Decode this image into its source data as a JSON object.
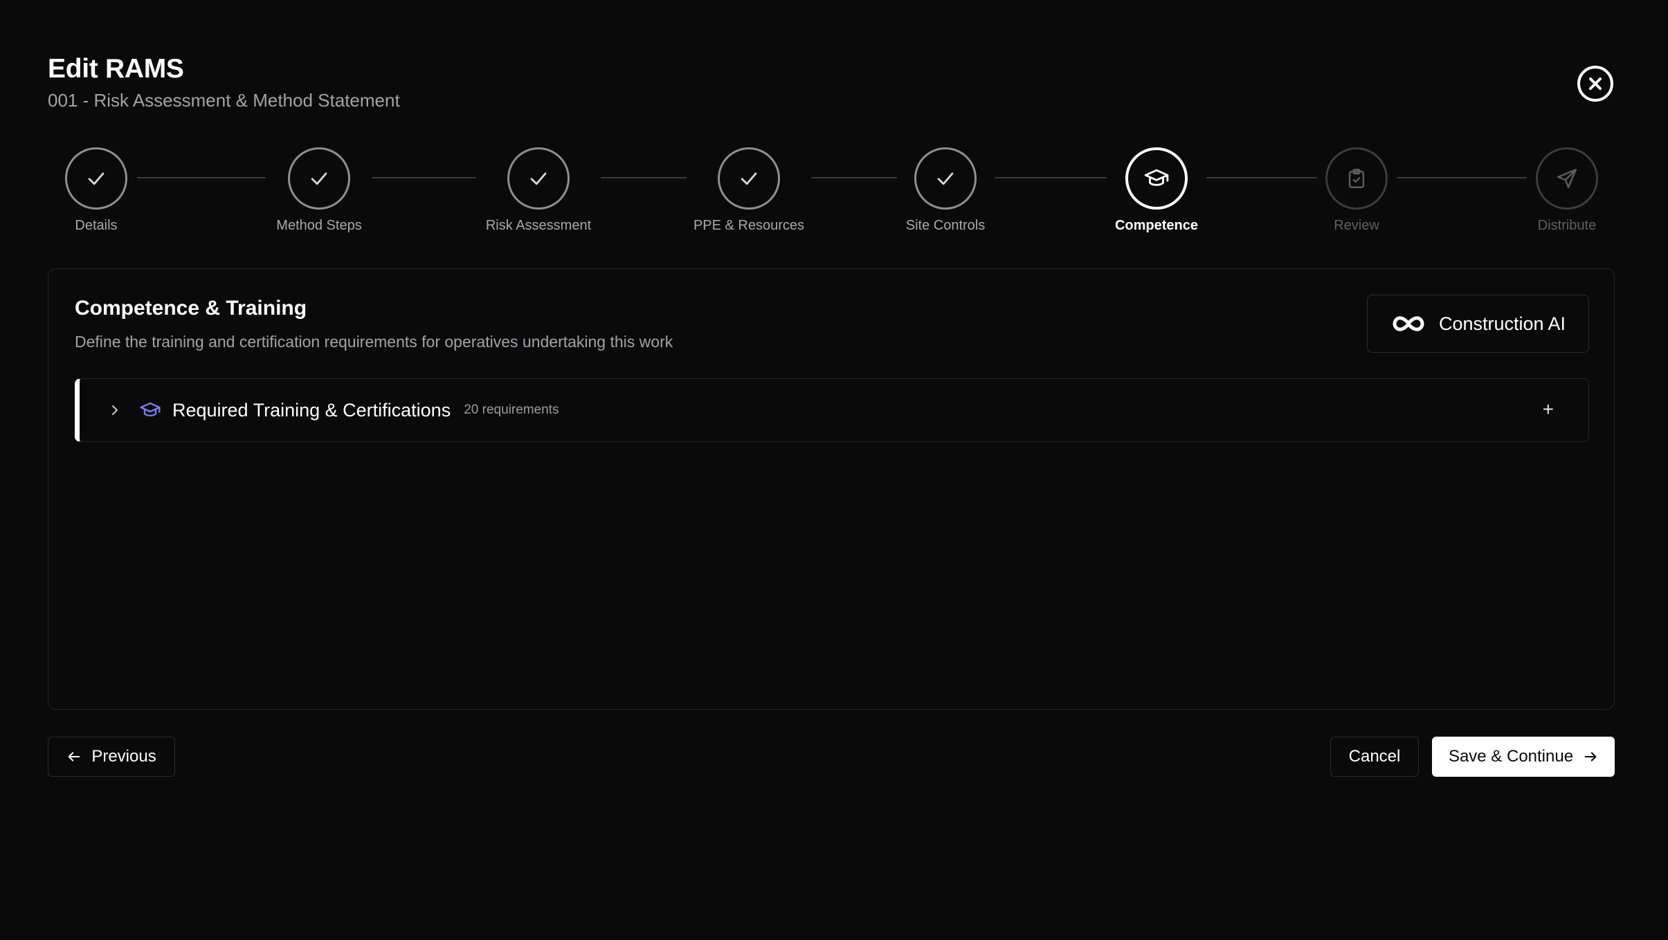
{
  "header": {
    "title": "Edit RAMS",
    "subtitle": "001 - Risk Assessment & Method Statement"
  },
  "stepper": {
    "steps": [
      {
        "label": "Details",
        "state": "complete",
        "icon": "check-icon"
      },
      {
        "label": "Method Steps",
        "state": "complete",
        "icon": "check-icon"
      },
      {
        "label": "Risk Assessment",
        "state": "complete",
        "icon": "check-icon"
      },
      {
        "label": "PPE & Resources",
        "state": "complete",
        "icon": "check-icon"
      },
      {
        "label": "Site Controls",
        "state": "complete",
        "icon": "check-icon"
      },
      {
        "label": "Competence",
        "state": "active",
        "icon": "graduation-cap-icon"
      },
      {
        "label": "Review",
        "state": "pending",
        "icon": "clipboard-check-icon"
      },
      {
        "label": "Distribute",
        "state": "pending",
        "icon": "send-icon"
      }
    ]
  },
  "card": {
    "title": "Competence & Training",
    "description": "Define the training and certification requirements for operatives undertaking this work",
    "ai_button": {
      "label": "Construction AI",
      "icon": "infinity-icon"
    },
    "section": {
      "title": "Required Training & Certifications",
      "count_label": "20 requirements",
      "icon": "graduation-cap-icon",
      "icon_color": "#7b7cf0",
      "add_label": "+"
    }
  },
  "footer": {
    "previous_label": "Previous",
    "cancel_label": "Cancel",
    "save_label": "Save & Continue"
  }
}
